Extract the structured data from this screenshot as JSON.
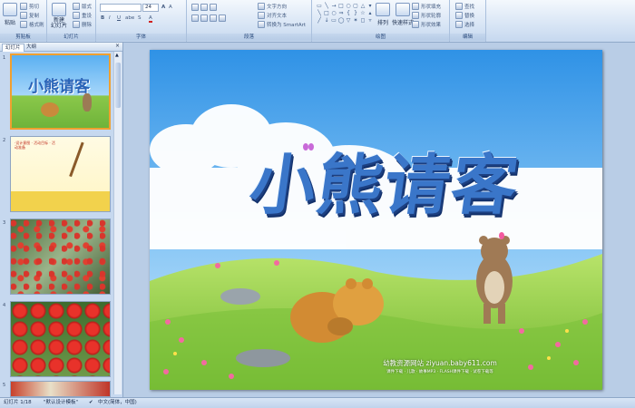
{
  "ribbon": {
    "clipboard": {
      "paste": "粘贴",
      "cut": "剪切",
      "copy": "复制",
      "format_painter": "格式刷",
      "label": "剪贴板"
    },
    "slides": {
      "new_slide": "新建\n幻灯片",
      "layout": "版式",
      "reset": "重设",
      "delete": "删除",
      "label": "幻灯片"
    },
    "font": {
      "size": "24",
      "label": "字体"
    },
    "paragraph": {
      "text_direction": "文字方向",
      "align_text": "对齐文本",
      "smartart": "转换为 SmartArt",
      "label": "段落"
    },
    "drawing": {
      "arrange": "排列",
      "quick_styles": "快速样式",
      "shape_fill": "形状填充",
      "shape_outline": "形状轮廓",
      "shape_effects": "形状效果",
      "label": "绘图"
    },
    "editing": {
      "find": "查找",
      "replace": "替换",
      "select": "选择",
      "label": "编辑"
    }
  },
  "left_pane": {
    "tabs": [
      "幻灯片",
      "大纲"
    ],
    "thumbnails": [
      {
        "num": "1",
        "title": "小熊请客"
      },
      {
        "num": "2",
        "text": "·设计意图 · 活动目标 · 活动准备"
      },
      {
        "num": "3"
      },
      {
        "num": "4"
      },
      {
        "num": "5"
      }
    ]
  },
  "slide": {
    "title": "小熊请客",
    "footer_main": "幼教资源网站  ziyuan.baby611.com",
    "footer_sub": "课件下载 · 儿歌 · 故事MP3 · FLASH课件下载 · 试卷下载等"
  },
  "status": {
    "slide_count": "幻灯片 1/18",
    "theme": "\"默认设计模板\"",
    "language": "中文(简体，中国)"
  },
  "colors": {
    "title_fill": "#3a76c9",
    "sky": "#49a7ec",
    "grass": "#8acc46",
    "selection": "#f0a030"
  }
}
